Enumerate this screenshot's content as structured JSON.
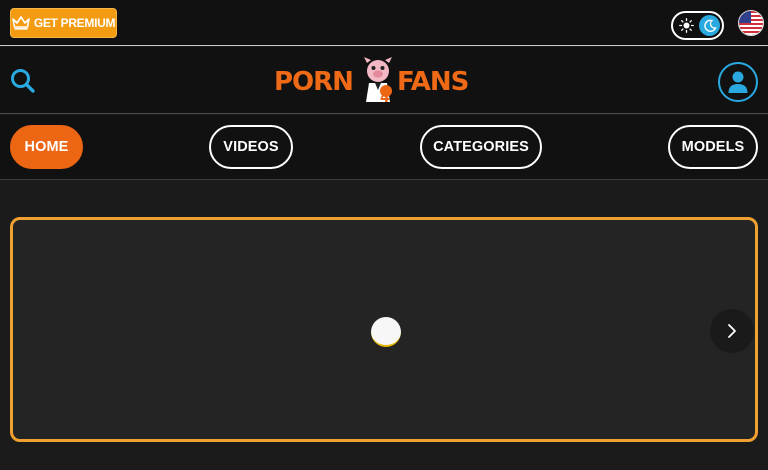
{
  "topbar": {
    "premium_label": "GET PREMIUM",
    "premium_icon": "crown-icon",
    "theme_toggle": {
      "light_icon": "sun-icon",
      "dark_icon": "moon-icon",
      "state": "dark"
    },
    "language_icon": "us-flag-icon"
  },
  "header": {
    "search_icon": "search-icon",
    "logo": {
      "left_text": "PORN",
      "right_text": "FANS",
      "mascot_icon": "mascot-icon"
    },
    "user_icon": "user-icon"
  },
  "nav": {
    "items": [
      {
        "label": "HOME",
        "active": true
      },
      {
        "label": "VIDEOS",
        "active": false
      },
      {
        "label": "CATEGORIES",
        "active": false
      },
      {
        "label": "MODELS",
        "active": false
      }
    ]
  },
  "carousel": {
    "loading_icon": "loading-spinner",
    "next_icon": "chevron-right-icon"
  },
  "colors": {
    "accent_orange": "#ec6614",
    "premium_yellow": "#f39c12",
    "carousel_border": "#f0a030",
    "icon_blue": "#2aa9e0",
    "background": "#111111"
  }
}
